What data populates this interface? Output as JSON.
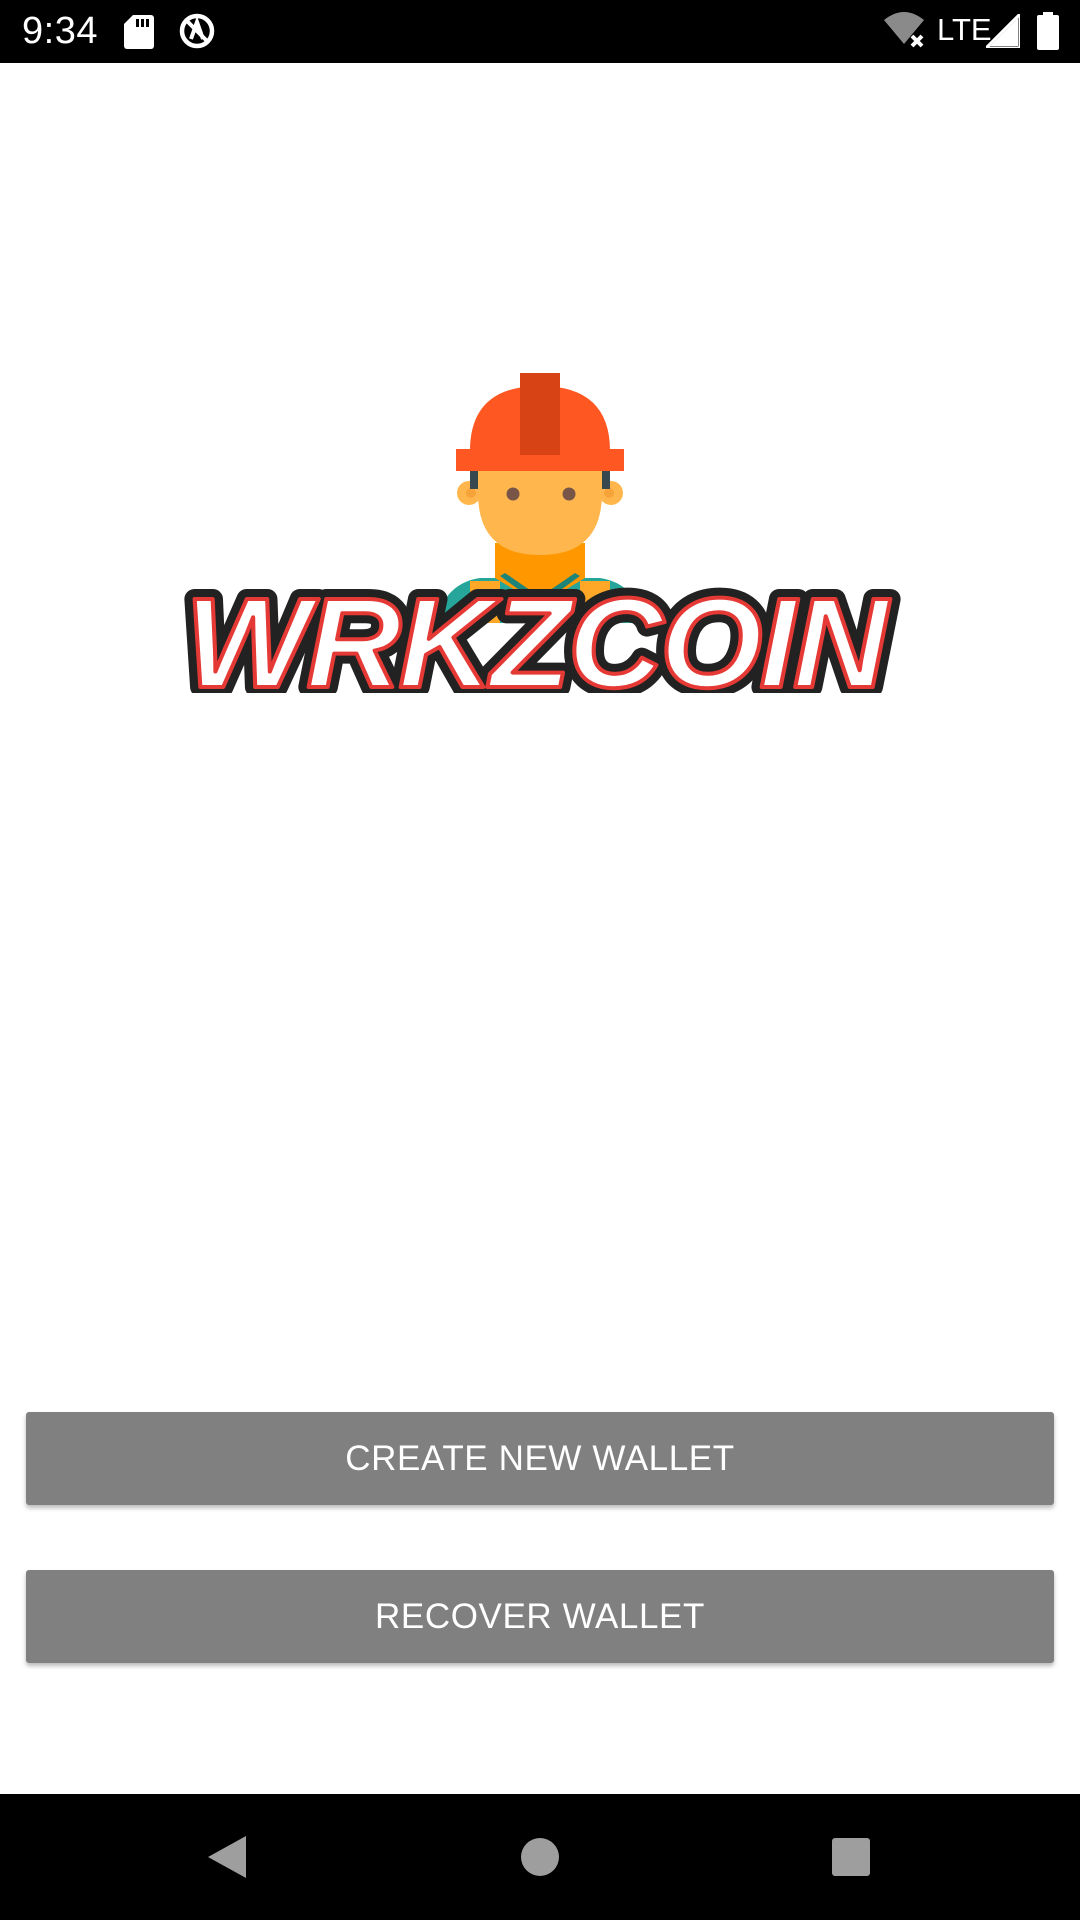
{
  "status_bar": {
    "time": "9:34",
    "network": "LTE",
    "icons": [
      "sd-card-icon",
      "no-data-icon",
      "wifi-off-icon",
      "cell-signal-icon",
      "battery-icon"
    ]
  },
  "logo": {
    "text": "WRKZCOIN",
    "colors": {
      "helmet": "#FF5722",
      "helmet_stripe": "#D84315",
      "skin": "#FFB74D",
      "shirt": "#26A69A",
      "vest": "#FFA726"
    }
  },
  "actions": {
    "create_label": "CREATE NEW WALLET",
    "recover_label": "RECOVER WALLET",
    "button_color": "#808080"
  },
  "nav_bar": {
    "buttons": [
      "back-icon",
      "home-icon",
      "recents-icon"
    ]
  }
}
